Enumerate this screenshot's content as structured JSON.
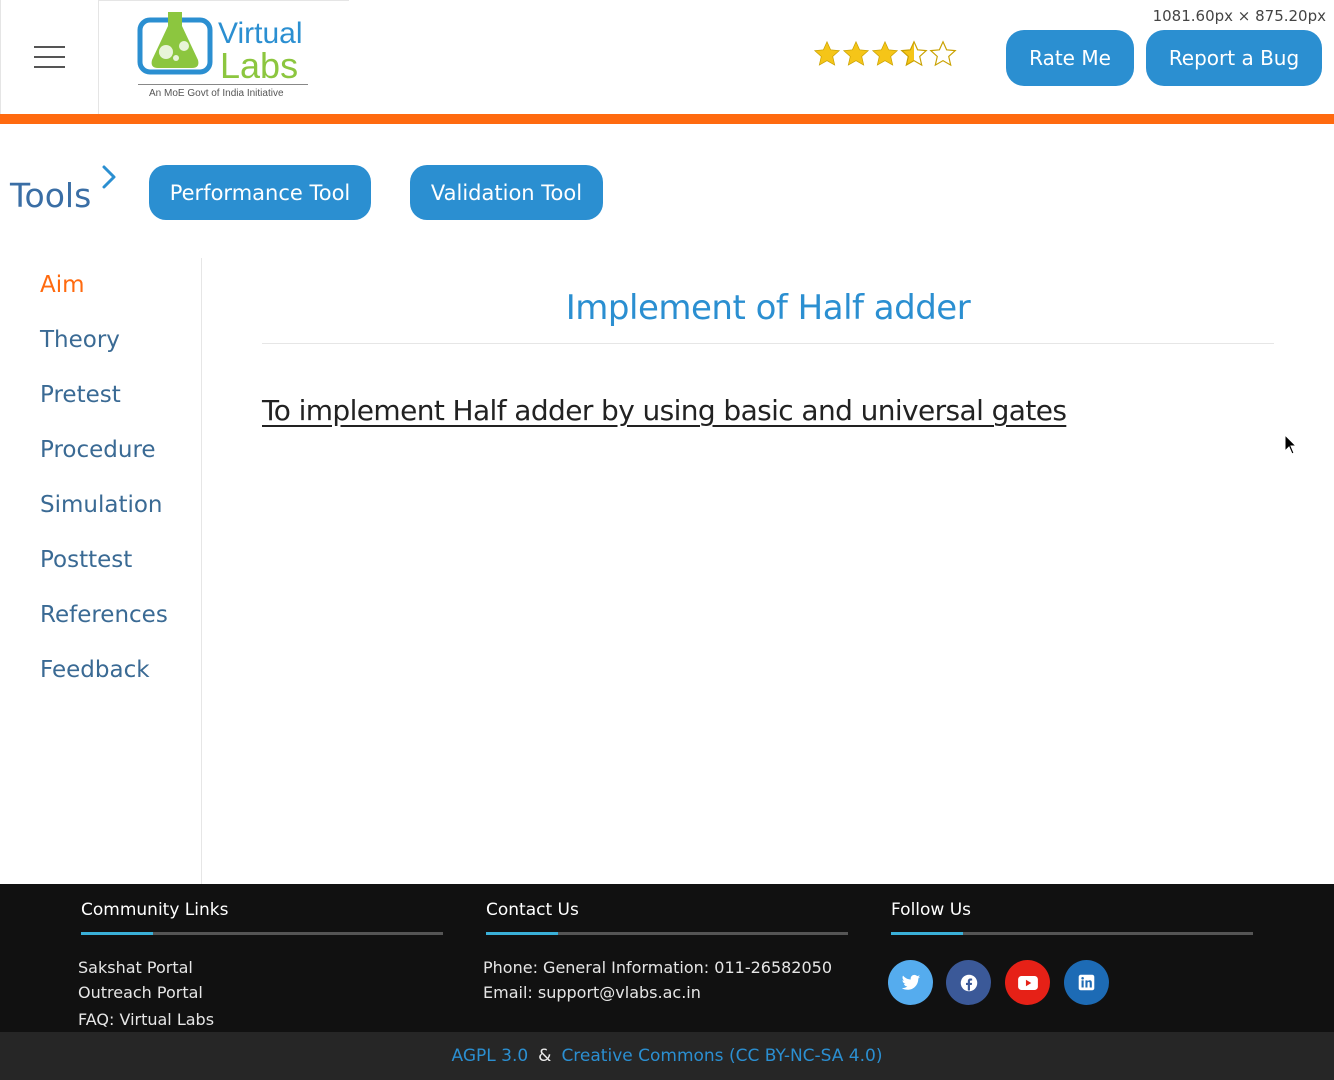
{
  "header": {
    "logo_word_1": "Virtual",
    "logo_word_2": "Labs",
    "logo_tagline": "An MoE Govt of India Initiative",
    "size_readout": "1081.60px × 875.20px",
    "rating": 3.5,
    "rating_max": 5,
    "rate_label": "Rate Me",
    "bug_label": "Report a Bug"
  },
  "tools": {
    "label": "Tools",
    "performance": "Performance Tool",
    "validation": "Validation Tool"
  },
  "sidebar": {
    "items": [
      {
        "label": "Aim",
        "active": true
      },
      {
        "label": "Theory"
      },
      {
        "label": "Pretest"
      },
      {
        "label": "Procedure"
      },
      {
        "label": "Simulation"
      },
      {
        "label": "Posttest"
      },
      {
        "label": "References"
      },
      {
        "label": "Feedback"
      }
    ]
  },
  "main": {
    "title": "Implement of Half adder",
    "aim": "To implement Half adder by using basic and universal gates"
  },
  "footer": {
    "community": {
      "heading": "Community Links",
      "links": [
        "Sakshat Portal",
        "Outreach Portal",
        "FAQ: Virtual Labs"
      ]
    },
    "contact": {
      "heading": "Contact Us",
      "phone": "Phone: General Information: 011-26582050",
      "email": "Email: support@vlabs.ac.in"
    },
    "follow": {
      "heading": "Follow Us",
      "icons": [
        "twitter-icon",
        "facebook-icon",
        "youtube-icon",
        "linkedin-icon"
      ]
    },
    "license": {
      "agpl": "AGPL 3.0",
      "amp": "&",
      "cc": "Creative Commons (CC BY-NC-SA 4.0)"
    }
  },
  "colors": {
    "accent_orange": "#ff6a0f",
    "button_blue": "#2b8fd1",
    "nav_blue": "#3a6a94",
    "star_gold": "#f5c518",
    "footer_bg": "#111111",
    "twitter": "#55acee",
    "facebook": "#3b5998",
    "youtube": "#e62117",
    "linkedin": "#1d6bb5"
  }
}
